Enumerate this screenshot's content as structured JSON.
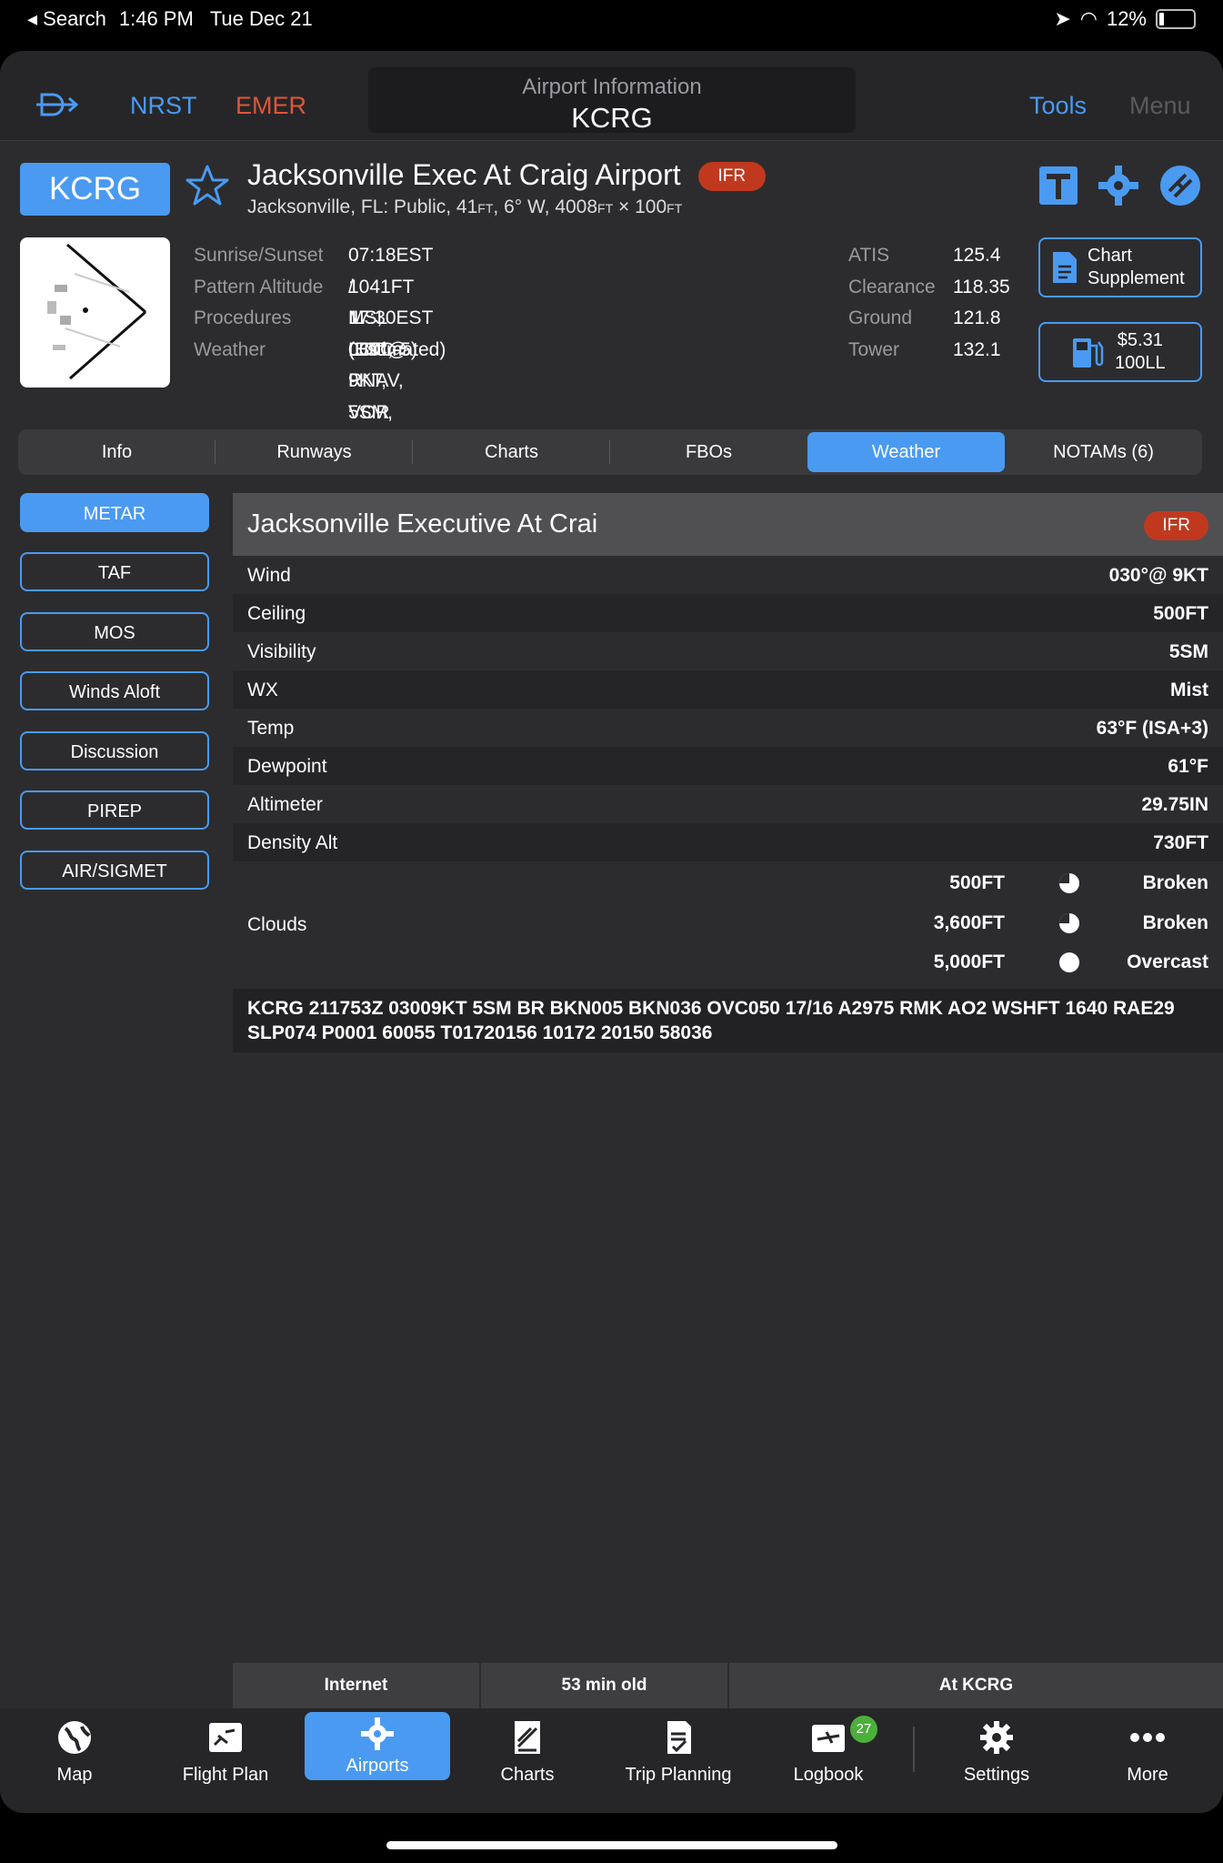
{
  "status_bar": {
    "back_app": "Search",
    "time": "1:46 PM",
    "date": "Tue Dec 21",
    "battery": "12%"
  },
  "nav": {
    "nrst": "NRST",
    "emer": "EMER",
    "title_label": "Airport Information",
    "title_id": "KCRG",
    "tools": "Tools",
    "menu": "Menu"
  },
  "airport": {
    "id": "KCRG",
    "name": "Jacksonville Exec At Craig Airport",
    "flight_rules": "IFR",
    "sub_prefix": "Jacksonville, FL: Public, 41",
    "sub_u1": "ft",
    "sub_mid": ", 6° W, 4008",
    "sub_u2": "ft",
    "sub_mid2": " × 100",
    "sub_u3": "ft",
    "info": [
      {
        "key": "Sunrise/Sunset",
        "value": "07:18EST / 17:30EST (UTC-5)"
      },
      {
        "key": "Pattern Altitude",
        "value": "1041FT MSL (Estimated)"
      },
      {
        "key": "Procedures",
        "value": "ILS, LOC, RNAV, VOR"
      },
      {
        "key": "Weather",
        "value": "030°@ 9KT, 5SM, 500FT"
      }
    ],
    "freqs": [
      {
        "key": "ATIS",
        "value": "125.4"
      },
      {
        "key": "Clearance",
        "value": "118.35"
      },
      {
        "key": "Ground",
        "value": "121.8"
      },
      {
        "key": "Tower",
        "value": "132.1"
      }
    ],
    "chart_supplement": [
      "Chart",
      "Supplement"
    ],
    "fuel_price": "$5.31",
    "fuel_type": "100LL"
  },
  "tabs": [
    "Info",
    "Runways",
    "Charts",
    "FBOs",
    "Weather",
    "NOTAMs (6)"
  ],
  "side_buttons": [
    "METAR",
    "TAF",
    "MOS",
    "Winds Aloft",
    "Discussion",
    "PIREP",
    "AIR/SIGMET"
  ],
  "metar": {
    "station": "Jacksonville Executive At Crai",
    "flight_rules": "IFR",
    "rows": [
      {
        "key": "Wind",
        "value": "030°@ 9KT"
      },
      {
        "key": "Ceiling",
        "value": "500FT"
      },
      {
        "key": "Visibility",
        "value": "5SM"
      },
      {
        "key": "WX",
        "value": "Mist"
      },
      {
        "key": "Temp",
        "value": "63°F (ISA+3)"
      },
      {
        "key": "Dewpoint",
        "value": "61°F"
      },
      {
        "key": "Altimeter",
        "value": "29.75IN"
      },
      {
        "key": "Density Alt",
        "value": "730FT"
      }
    ],
    "clouds_label": "Clouds",
    "clouds": [
      {
        "alt": "500FT",
        "cover": "Broken"
      },
      {
        "alt": "3,600FT",
        "cover": "Broken"
      },
      {
        "alt": "5,000FT",
        "cover": "Overcast"
      }
    ],
    "raw": "KCRG 211753Z 03009KT 5SM BR BKN005 BKN036 OVC050 17/16 A2975 RMK AO2 WSHFT 1640 RAE29 SLP074 P0001 60055 T01720156 10172 20150 58036"
  },
  "status_strip": {
    "source": "Internet",
    "age": "53 min old",
    "location": "At KCRG"
  },
  "tabbar": {
    "items": [
      "Map",
      "Flight Plan",
      "Airports",
      "Charts",
      "Trip Planning",
      "Logbook",
      "Settings",
      "More"
    ],
    "logbook_badge": "27"
  },
  "colors": {
    "accent": "#4a9af2",
    "ifr": "#c0391f",
    "emer": "#e0553a",
    "background": "#2c2c2e"
  }
}
